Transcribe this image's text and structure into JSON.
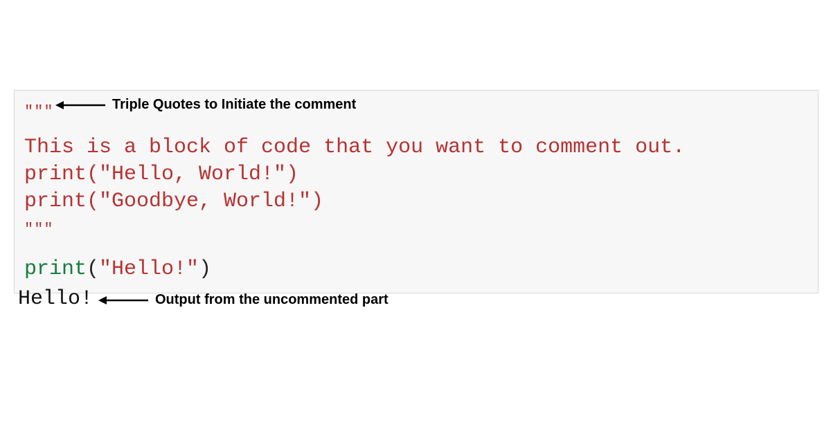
{
  "code": {
    "open_quotes": "\"\"\"",
    "line1": "This is a block of code that you want to comment out.",
    "line2": "print(\"Hello, World!\")",
    "line3": "print(\"Goodbye, World!\")",
    "close_quotes": "\"\"\"",
    "exec_print": "print",
    "exec_open": "(",
    "exec_string": "\"Hello!\"",
    "exec_close": ")"
  },
  "output": {
    "text": "Hello!"
  },
  "annotations": {
    "top": "Triple Quotes to Initiate the comment",
    "bottom": "Output from the uncommented part"
  }
}
